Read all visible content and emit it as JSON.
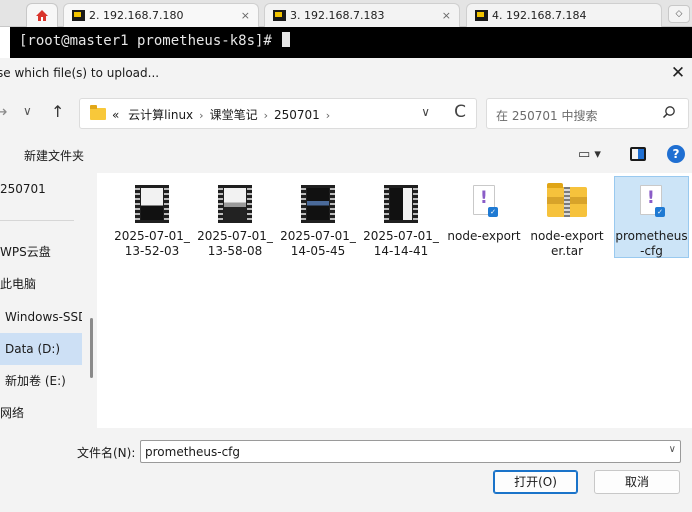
{
  "tabs": [
    {
      "label": "2. 192.168.7.180",
      "close": "×"
    },
    {
      "label": "3. 192.168.7.183",
      "close": "×"
    },
    {
      "label": "4. 192.168.7.184",
      "close": ""
    }
  ],
  "tab_more": "◇",
  "terminal": {
    "prompt": "[root@master1 prometheus-k8s]# "
  },
  "dialog": {
    "title": "se which file(s) to upload...",
    "close": "✕",
    "nav": {
      "back": "→",
      "down": "∨",
      "up": "↑"
    },
    "address": {
      "crumbs": [
        "«",
        "云计算linux",
        "课堂笔记",
        "250701"
      ],
      "sep": "›",
      "chevron": "∨",
      "refresh": "C"
    },
    "search": {
      "placeholder": "在 250701 中搜索"
    },
    "toolbar": {
      "new_folder": "新建文件夹",
      "view": "▭ ▾",
      "help": "?"
    },
    "sidebar": [
      {
        "label": "250701"
      },
      {
        "label": "WPS云盘"
      },
      {
        "label": "此电脑"
      },
      {
        "label": "Windows-SSD"
      },
      {
        "label": "Data (D:)"
      },
      {
        "label": "新加卷 (E:)"
      },
      {
        "label": "网络"
      }
    ],
    "files": [
      {
        "name": "2025-07-01_13-52-03",
        "type": "video"
      },
      {
        "name": "2025-07-01_13-58-08",
        "type": "video"
      },
      {
        "name": "2025-07-01_14-05-45",
        "type": "video"
      },
      {
        "name": "2025-07-01_14-14-41",
        "type": "video"
      },
      {
        "name": "node-export",
        "type": "config"
      },
      {
        "name": "node-exporter.tar",
        "type": "archive"
      },
      {
        "name": "prometheus-cfg",
        "type": "config"
      }
    ],
    "filename": {
      "label": "文件名(N):",
      "value": "prometheus-cfg",
      "chevron": "∨"
    },
    "buttons": {
      "open": "打开(O)",
      "cancel": "取消"
    }
  }
}
